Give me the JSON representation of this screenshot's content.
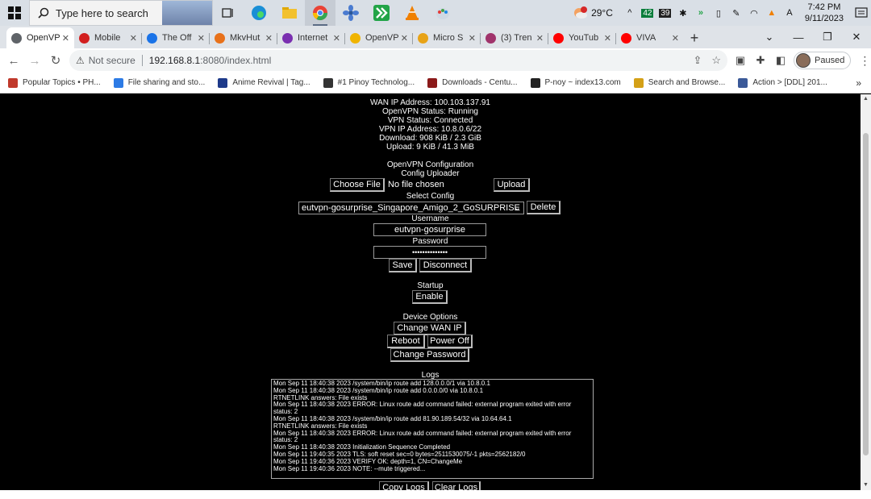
{
  "taskbar": {
    "search_placeholder": "Type here to search",
    "weather_temp": "29°C",
    "weather_badge": "1",
    "tray_badges": [
      "42",
      "39"
    ],
    "clock_time": "7:42 PM",
    "clock_date": "9/11/2023"
  },
  "tabs": [
    {
      "title": "OpenVP",
      "active": true,
      "fav_color": "#5f6368"
    },
    {
      "title": "Mobile",
      "fav_color": "#d21f1f"
    },
    {
      "title": "The Off",
      "fav_color": "#1a73e8"
    },
    {
      "title": "MkvHut",
      "fav_color": "#e8711a"
    },
    {
      "title": "Internet",
      "fav_color": "#7a2fb0"
    },
    {
      "title": "OpenVP",
      "fav_color": "#f0b400"
    },
    {
      "title": "Micro S",
      "fav_color": "#e8a317"
    },
    {
      "title": "(3) Tren",
      "fav_color": "#a0336b"
    },
    {
      "title": "YouTub",
      "fav_color": "#ff0000"
    },
    {
      "title": "VIVA",
      "fav_color": "#ff0000"
    }
  ],
  "new_tab": "+",
  "address": {
    "not_secure": "Not secure",
    "url_host": "192.168.8.1",
    "url_rest": ":8080/index.html",
    "profile_status": "Paused"
  },
  "bookmarks": [
    {
      "label": "Popular Topics • PH...",
      "color": "#c0392b"
    },
    {
      "label": "File sharing and sto...",
      "color": "#2d7be5"
    },
    {
      "label": "Anime Revival | Tag...",
      "color": "#1e3a8a"
    },
    {
      "label": "#1 Pinoy Technolog...",
      "color": "#333333"
    },
    {
      "label": "Downloads - Centu...",
      "color": "#8b1a1a"
    },
    {
      "label": "P-noy ~ index13.com",
      "color": "#222222"
    },
    {
      "label": "Search and Browse...",
      "color": "#d4a017"
    },
    {
      "label": "Action > [DDL] 201...",
      "color": "#3b5998"
    }
  ],
  "status": {
    "wan_ip": "WAN IP Address: 100.103.137.91",
    "openvpn_status": "OpenVPN Status: Running",
    "vpn_status": "VPN Status: Connected",
    "vpn_ip": "VPN IP Address: 10.8.0.6/22",
    "download": "Download: 908 KiB / 2.3 GiB",
    "upload": "Upload: 9 KiB / 41.3 MiB"
  },
  "config": {
    "section_title": "OpenVPN Configuration",
    "uploader_title": "Config Uploader",
    "choose_file": "Choose File",
    "no_file": "No file chosen",
    "upload": "Upload",
    "select_title": "Select Config",
    "selected_config": "eutvpn-gosurprise_Singapore_Amigo_2_GoSURPRISE",
    "delete": "Delete",
    "username_label": "Username",
    "username_value": "eutvpn-gosurprise",
    "password_label": "Password",
    "password_value": "••••••••••••••",
    "save": "Save",
    "disconnect": "Disconnect"
  },
  "startup": {
    "title": "Startup",
    "enable": "Enable"
  },
  "device": {
    "title": "Device Options",
    "change_wan_ip": "Change WAN IP",
    "reboot": "Reboot",
    "power_off": "Power Off",
    "change_password": "Change Password"
  },
  "logs": {
    "title": "Logs",
    "lines": [
      "Mon Sep 11 18:40:38 2023 /system/bin/ip route add 128.0.0.0/1 via 10.8.0.1",
      "Mon Sep 11 18:40:38 2023 /system/bin/ip route add 0.0.0.0/0 via 10.8.0.1",
      "RTNETLINK answers: File exists",
      "Mon Sep 11 18:40:38 2023 ERROR: Linux route add command failed: external program exited with error status: 2",
      "Mon Sep 11 18:40:38 2023 /system/bin/ip route add 81.90.189.54/32 via 10.64.64.1",
      "RTNETLINK answers: File exists",
      "Mon Sep 11 18:40:38 2023 ERROR: Linux route add command failed: external program exited with error status: 2",
      "Mon Sep 11 18:40:38 2023 Initialization Sequence Completed",
      "Mon Sep 11 19:40:35 2023 TLS: soft reset sec=0 bytes=2511530075/-1 pkts=2562182/0",
      "Mon Sep 11 19:40:36 2023 VERIFY OK: depth=1, CN=ChangeMe",
      "Mon Sep 11 19:40:36 2023 NOTE: --mute triggered..."
    ],
    "copy": "Copy Logs",
    "clear": "Clear Logs"
  }
}
